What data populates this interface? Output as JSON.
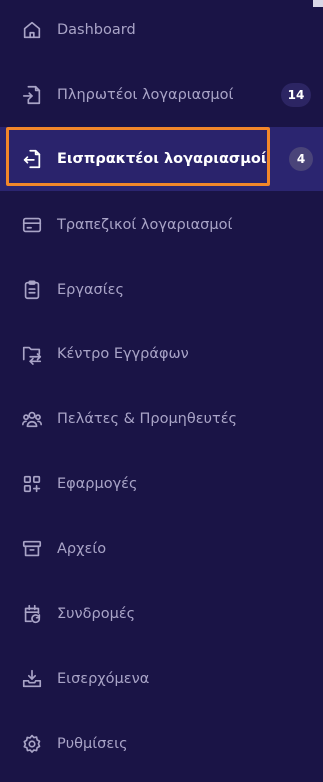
{
  "nav": {
    "items": [
      {
        "label": "Dashboard",
        "icon": "home-icon"
      },
      {
        "label": "Πληρωτέοι λογαριασμοί",
        "icon": "file-import-icon",
        "badge": "14"
      },
      {
        "label": "Εισπρακτέοι λογαριασμοί",
        "icon": "file-export-icon",
        "badge": "4",
        "active": true
      },
      {
        "label": "Τραπεζικοί λογαριασμοί",
        "icon": "credit-card-icon"
      },
      {
        "label": "Εργασίες",
        "icon": "clipboard-icon"
      },
      {
        "label": "Κέντρο Εγγράφων",
        "icon": "folder-transfer-icon"
      },
      {
        "label": "Πελάτες & Προμηθευτές",
        "icon": "users-icon"
      },
      {
        "label": "Εφαρμογές",
        "icon": "apps-add-icon"
      },
      {
        "label": "Αρχείο",
        "icon": "archive-icon"
      },
      {
        "label": "Συνδρομές",
        "icon": "calendar-repeat-icon"
      },
      {
        "label": "Εισερχόμενα",
        "icon": "inbox-download-icon"
      },
      {
        "label": "Ρυθμίσεις",
        "icon": "settings-gear-icon"
      }
    ]
  },
  "colors": {
    "background": "#1a1446",
    "active_background": "#2b2570",
    "highlight_border": "#f2872a",
    "inactive_text": "#a9a4c7",
    "active_text": "#ffffff"
  }
}
